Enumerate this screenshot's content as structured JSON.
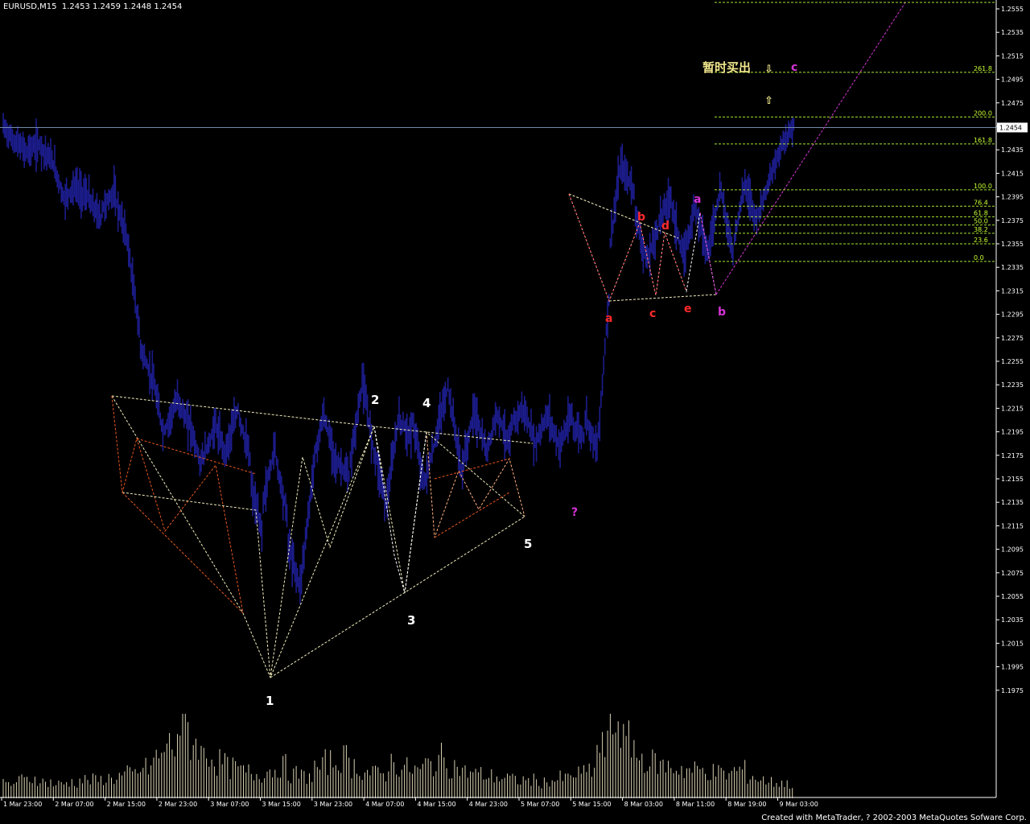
{
  "header": {
    "symbol": "EURUSD,M15",
    "ohlc": "1.2453 1.2459 1.2448 1.2454"
  },
  "footer": {
    "credit": "Created with MetaTrader, ? 2002-2003 MetaQuotes Sofware Corp."
  },
  "colors": {
    "background": "#000000",
    "price": "#1c1c8c",
    "volume": "#d9d0b2",
    "grid_axis": "#ffffff",
    "current_price_line": "#6f8aa8",
    "fib": "#a6e632",
    "channel": "#f2eebd",
    "sub_wave": "#e8571f",
    "triangle_wave": "#ffb080",
    "magenta": "#d633d6",
    "red_label": "#ff2a2a",
    "yellow_label": "#f0e68c",
    "white_label": "#ffffff"
  },
  "chart_data": {
    "type": "candlestick",
    "title": "EURUSD,M15",
    "ylim": [
      1.1965,
      1.2565
    ],
    "y_ticks": [
      "1.2555",
      "1.2535",
      "1.2515",
      "1.2495",
      "1.2475",
      "1.2455",
      "1.2435",
      "1.2415",
      "1.2395",
      "1.2375",
      "1.2355",
      "1.2335",
      "1.2315",
      "1.2295",
      "1.2275",
      "1.2255",
      "1.2235",
      "1.2215",
      "1.2195",
      "1.2175",
      "1.2155",
      "1.2135",
      "1.2115",
      "1.2095",
      "1.2075",
      "1.2055",
      "1.2035",
      "1.2015",
      "1.1995",
      "1.1975"
    ],
    "x_ticks": [
      "1 Mar 23:00",
      "2 Mar 07:00",
      "2 Mar 15:00",
      "2 Mar 23:00",
      "3 Mar 07:00",
      "3 Mar 15:00",
      "3 Mar 23:00",
      "4 Mar 07:00",
      "4 Mar 15:00",
      "4 Mar 23:00",
      "5 Mar 07:00",
      "5 Mar 15:00",
      "8 Mar 03:00",
      "8 Mar 11:00",
      "8 Mar 19:00",
      "9 Mar 03:00"
    ],
    "current_price": "1.2454",
    "price_series": [
      [
        1.2455,
        1.244
      ],
      [
        1.2442,
        1.2432
      ],
      [
        1.2435,
        1.244
      ],
      [
        1.2438,
        1.2425
      ],
      [
        1.2425,
        1.239
      ],
      [
        1.2395,
        1.2405
      ],
      [
        1.24,
        1.2395
      ],
      [
        1.239,
        1.2375
      ],
      [
        1.2385,
        1.24
      ],
      [
        1.2395,
        1.236
      ],
      [
        1.236,
        1.228
      ],
      [
        1.227,
        1.224
      ],
      [
        1.2245,
        1.219
      ],
      [
        1.2195,
        1.222
      ],
      [
        1.2225,
        1.22
      ],
      [
        1.2205,
        1.2165
      ],
      [
        1.217,
        1.2195
      ],
      [
        1.2205,
        1.2175
      ],
      [
        1.218,
        1.2215
      ],
      [
        1.221,
        1.217
      ],
      [
        1.215,
        1.2105
      ],
      [
        1.2135,
        1.2185
      ],
      [
        1.2175,
        1.212
      ],
      [
        1.21,
        1.2062
      ],
      [
        1.2065,
        1.2155
      ],
      [
        1.2165,
        1.2215
      ],
      [
        1.2205,
        1.2165
      ],
      [
        1.217,
        1.2155
      ],
      [
        1.2165,
        1.2235
      ],
      [
        1.224,
        1.2175
      ],
      [
        1.218,
        1.213
      ],
      [
        1.2135,
        1.2212
      ],
      [
        1.2205,
        1.219
      ],
      [
        1.221,
        1.215
      ],
      [
        1.215,
        1.219
      ],
      [
        1.2195,
        1.2235
      ],
      [
        1.223,
        1.2165
      ],
      [
        1.216,
        1.221
      ],
      [
        1.2215,
        1.218
      ],
      [
        1.2175,
        1.2215
      ],
      [
        1.221,
        1.218
      ],
      [
        1.22,
        1.2215
      ],
      [
        1.2215,
        1.2185
      ],
      [
        1.2185,
        1.221
      ],
      [
        1.221,
        1.218
      ],
      [
        1.2185,
        1.221
      ],
      [
        1.22,
        1.219
      ],
      [
        1.221,
        1.218
      ],
      [
        1.218,
        1.2315
      ],
      [
        1.235,
        1.243
      ],
      [
        1.242,
        1.24
      ],
      [
        1.2385,
        1.2338
      ],
      [
        1.234,
        1.237
      ],
      [
        1.2375,
        1.2395
      ],
      [
        1.239,
        1.234
      ],
      [
        1.2345,
        1.239
      ],
      [
        1.2385,
        1.2345
      ],
      [
        1.235,
        1.2405
      ],
      [
        1.24,
        1.2345
      ],
      [
        1.2355,
        1.241
      ],
      [
        1.2405,
        1.2372
      ],
      [
        1.238,
        1.2412
      ],
      [
        1.241,
        1.2442
      ],
      [
        1.244,
        1.246
      ]
    ],
    "volume_series": [
      7,
      9,
      10,
      8,
      7,
      8,
      9,
      9,
      10,
      11,
      12,
      15,
      20,
      26,
      35,
      28,
      22,
      18,
      15,
      13,
      12,
      14,
      16,
      12,
      11,
      15,
      18,
      20,
      16,
      13,
      12,
      18,
      15,
      14,
      17,
      20,
      16,
      13,
      12,
      11,
      10,
      9,
      9,
      8,
      9,
      10,
      12,
      14,
      25,
      38,
      28,
      20,
      18,
      16,
      15,
      14,
      14,
      13,
      12,
      14,
      11,
      9,
      8,
      7
    ],
    "annotations": {
      "wave_numbers": [
        "1",
        "2",
        "3",
        "4",
        "5"
      ],
      "triangle_labels": [
        "a",
        "b",
        "c",
        "d",
        "e"
      ],
      "magenta_labels": [
        "a",
        "b",
        "c",
        "?"
      ],
      "chinese_note": "暂时买出",
      "arrow_down": "⇩",
      "arrow_up": "⇧"
    },
    "fibonacci": {
      "levels": [
        "261.8",
        "200.0",
        "161.8",
        "100.0",
        "76.4",
        "61.8",
        "50.0",
        "38.2",
        "23.6",
        "0.0"
      ],
      "prices": [
        1.2501,
        1.2463,
        1.244,
        1.2401,
        1.2387,
        1.2378,
        1.2371,
        1.2364,
        1.2355,
        1.234
      ]
    }
  }
}
